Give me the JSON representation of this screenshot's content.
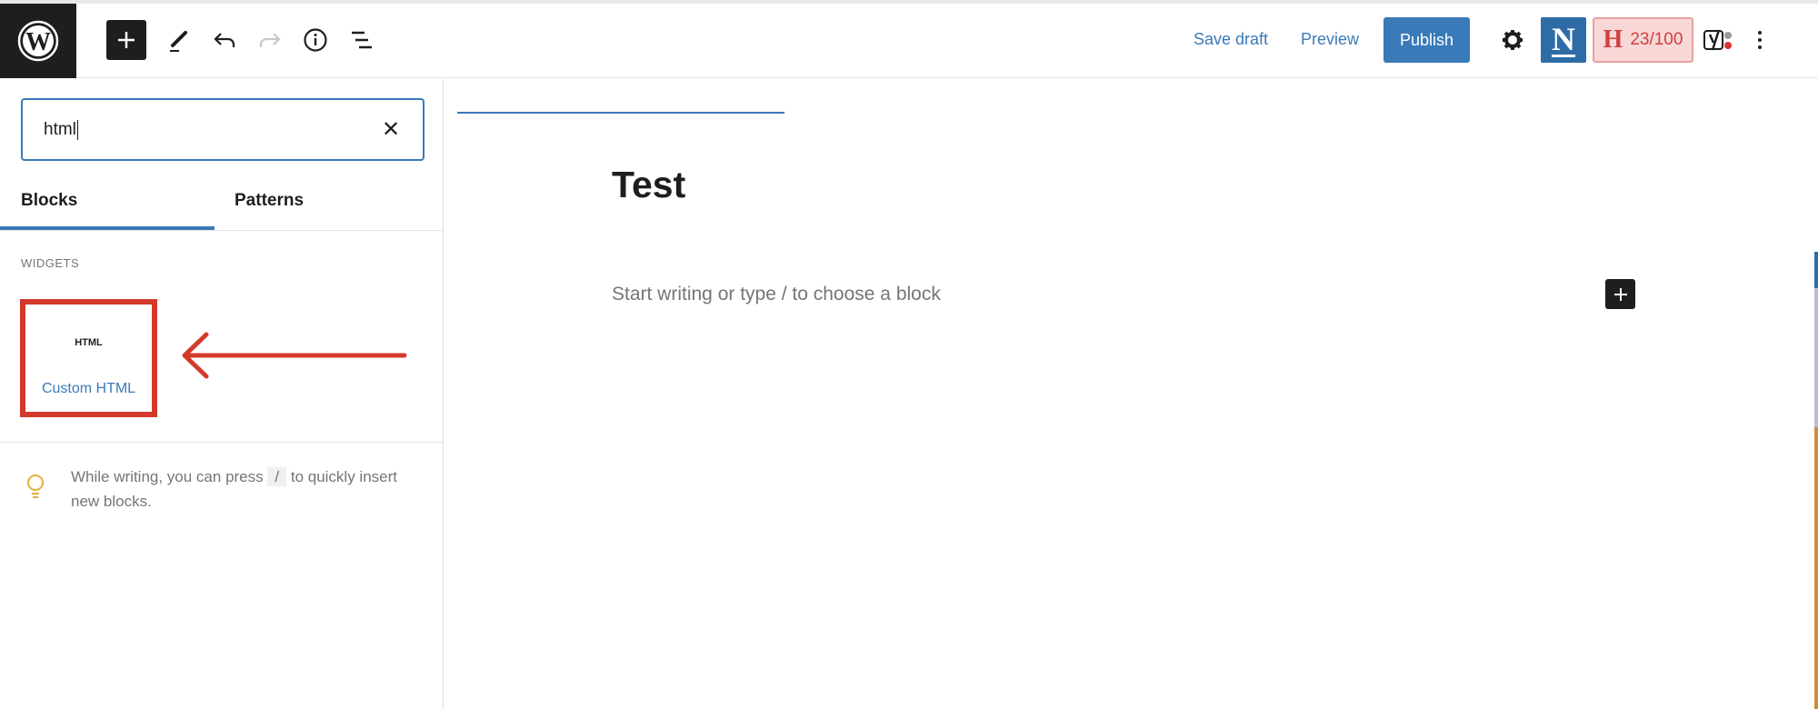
{
  "toolbar": {
    "logo_icon": "wordpress-logo",
    "tools": [
      "add-block-icon",
      "pencil-icon",
      "undo-icon",
      "redo-icon",
      "info-icon",
      "list-view-icon"
    ],
    "save_draft": "Save draft",
    "preview": "Preview",
    "publish": "Publish",
    "plugin_n": "N",
    "seo_letter": "H",
    "seo_score": "23/100",
    "accent": "#3a7ab8"
  },
  "inserter": {
    "search_value": "html",
    "tabs": [
      {
        "label": "Blocks",
        "active": true
      },
      {
        "label": "Patterns",
        "active": false
      }
    ],
    "category": "WIDGETS",
    "block": {
      "icon_text": "HTML",
      "label": "Custom HTML"
    },
    "tip": {
      "before": "While writing, you can press",
      "key": "/",
      "after": "to quickly insert new blocks."
    }
  },
  "editor": {
    "title": "Test",
    "placeholder": "Start writing or type / to choose a block"
  },
  "annotation": {
    "color": "#d33a2c"
  }
}
